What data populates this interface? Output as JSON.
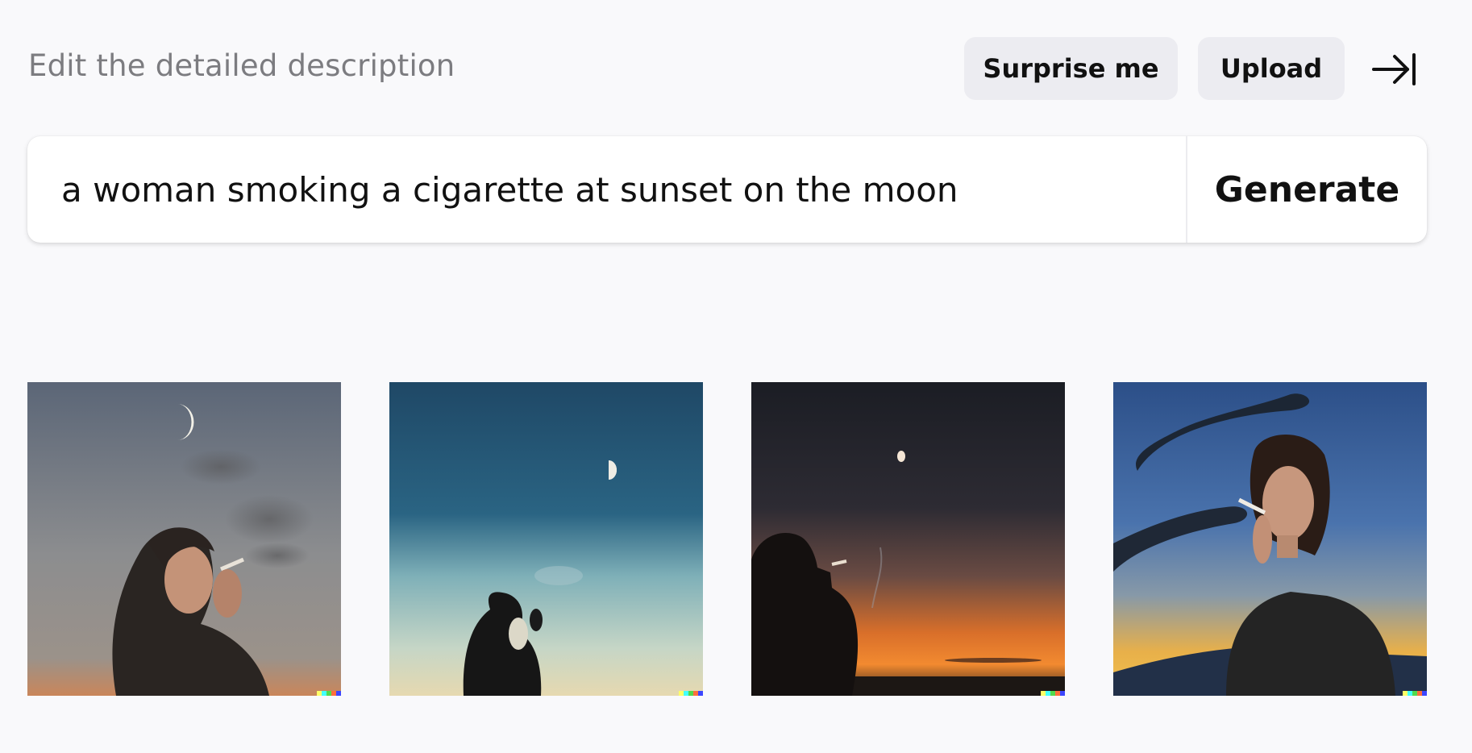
{
  "header": {
    "label": "Edit the detailed description",
    "surprise_label": "Surprise me",
    "upload_label": "Upload",
    "collapse_icon": "arrow-to-right-icon"
  },
  "prompt": {
    "value": "a woman smoking a cigarette at sunset on the moon",
    "generate_label": "Generate"
  },
  "results": {
    "images": [
      {
        "subject": "woman smoking under crescent moon, grey dusk sky"
      },
      {
        "subject": "silhouette of woman smoking under half moon, teal sky"
      },
      {
        "subject": "silhouette smoking against orange sunset horizon"
      },
      {
        "subject": "woman in black sweater smoking, blue sky with clouds"
      }
    ],
    "watermark_colors": [
      "#ffff66",
      "#42ffff",
      "#51da4c",
      "#ff6e3c",
      "#3c46ff"
    ]
  }
}
